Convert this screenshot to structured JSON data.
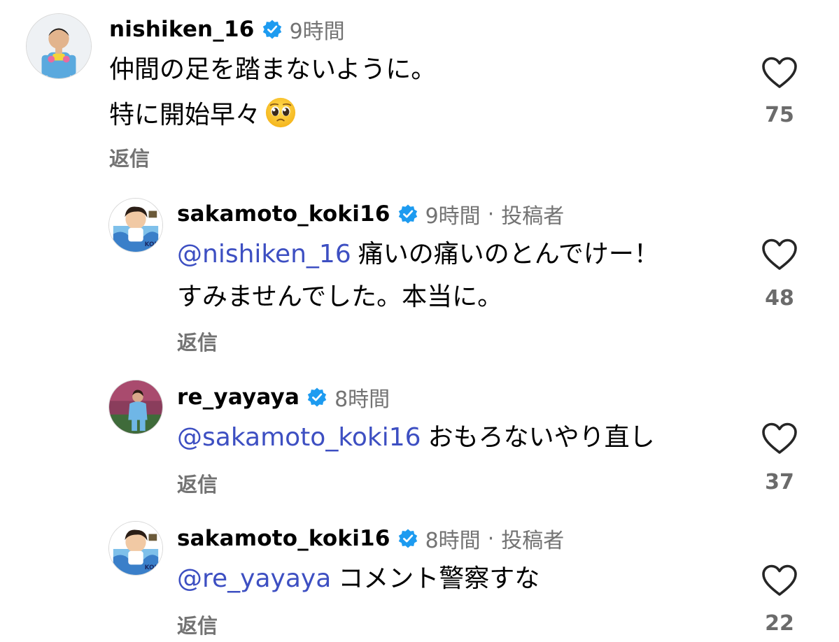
{
  "colors": {
    "text": "#000000",
    "muted": "#737373",
    "mention": "#3d4fc2",
    "verified": "#1d9bf0"
  },
  "comments": [
    {
      "username": "nishiken_16",
      "time": "9時間",
      "author_badge": "",
      "lines": [
        "仲間の足を踏まないように。",
        "特に開始早々"
      ],
      "emoji": "pleading-face-emoji",
      "reply_label": "返信",
      "likes": "75"
    },
    {
      "username": "sakamoto_koki16",
      "time": "9時間",
      "author_badge": "投稿者",
      "mention": "@nishiken_16",
      "lines": [
        "痛いの痛いのとんでけー！",
        "すみませんでした。本当に。"
      ],
      "reply_label": "返信",
      "likes": "48"
    },
    {
      "username": "re_yayaya",
      "time": "8時間",
      "author_badge": "",
      "mention": "@sakamoto_koki16",
      "lines": [
        "おもろないやり直し"
      ],
      "reply_label": "返信",
      "likes": "37"
    },
    {
      "username": "sakamoto_koki16",
      "time": "8時間",
      "author_badge": "投稿者",
      "mention": "@re_yayaya",
      "lines": [
        "コメント警察すな"
      ],
      "reply_label": "返信",
      "likes": "22"
    }
  ]
}
